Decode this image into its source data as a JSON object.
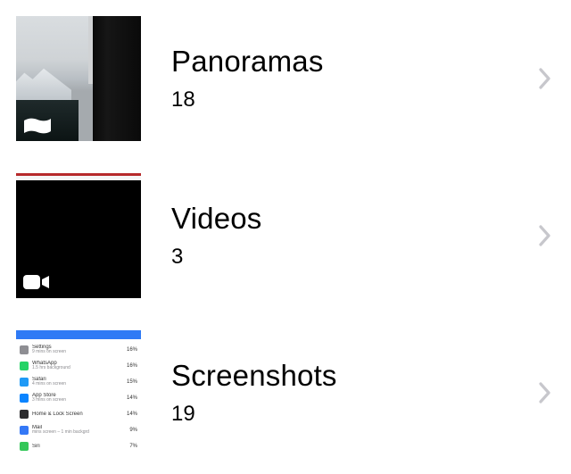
{
  "albums": [
    {
      "title": "Panoramas",
      "count": "18",
      "overlay_icon": "panorama-icon"
    },
    {
      "title": "Videos",
      "count": "3",
      "overlay_icon": "video-icon"
    },
    {
      "title": "Screenshots",
      "count": "19",
      "overlay_icon": null
    }
  ],
  "screenshot_thumb": {
    "rows": [
      {
        "icon_color": "#8e8e93",
        "label": "Settings",
        "sub": "9 mins on screen",
        "pct": "16%"
      },
      {
        "icon_color": "#25d366",
        "label": "WhatsApp",
        "sub": "1.5 hrs background",
        "pct": "16%"
      },
      {
        "icon_color": "#1f9af6",
        "label": "Safari",
        "sub": "4 mins on screen",
        "pct": "15%"
      },
      {
        "icon_color": "#0a84ff",
        "label": "App Store",
        "sub": "3 mins on screen",
        "pct": "14%"
      },
      {
        "icon_color": "#2c2c2e",
        "label": "Home & Lock Screen",
        "sub": "",
        "pct": "14%"
      },
      {
        "icon_color": "#3478f6",
        "label": "Mail",
        "sub": "mins screen – 1 min backgrd",
        "pct": "9%"
      },
      {
        "icon_color": "#34c759",
        "label": "Siri",
        "sub": "",
        "pct": "7%"
      }
    ]
  }
}
